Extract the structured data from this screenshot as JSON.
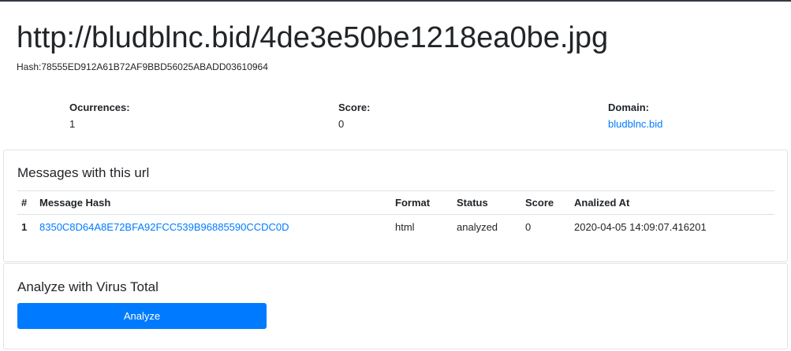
{
  "header": {
    "url": "http://bludblnc.bid/4de3e50be1218ea0be.jpg",
    "hash_line": "Hash:78555ED912A61B72AF9BBD56025ABADD03610964"
  },
  "stats": {
    "occurrences": {
      "label": "Ocurrences:",
      "value": "1"
    },
    "score": {
      "label": "Score:",
      "value": "0"
    },
    "domain": {
      "label": "Domain:",
      "value": "bludblnc.bid"
    }
  },
  "messages": {
    "title": "Messages with this url",
    "columns": [
      "#",
      "Message Hash",
      "Format",
      "Status",
      "Score",
      "Analized At"
    ],
    "rows": [
      {
        "index": "1",
        "hash": "8350C8D64A8E72BFA92FCC539B96885590CCDC0D",
        "format": "html",
        "status": "analyzed",
        "score": "0",
        "analyzed_at": "2020-04-05 14:09:07.416201"
      }
    ]
  },
  "analyze": {
    "title": "Analyze with Virus Total",
    "button_label": "Analyze"
  },
  "colors": {
    "link": "#007bff",
    "primary_button": "#007bff",
    "text": "#212529"
  }
}
